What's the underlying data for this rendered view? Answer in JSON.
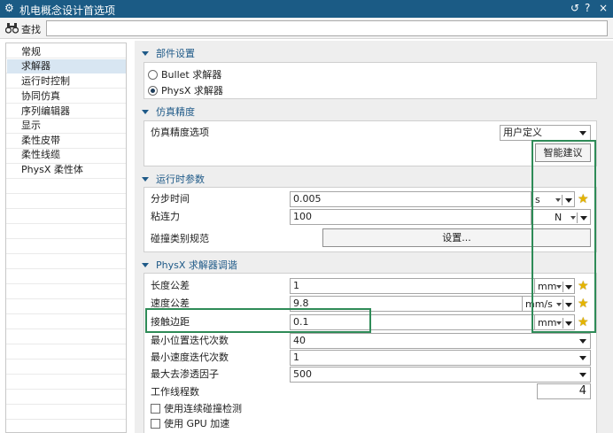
{
  "window": {
    "title": "机电概念设计首选项",
    "app_icon": "gear-icon",
    "controls": [
      "↺",
      "?",
      "×"
    ]
  },
  "search": {
    "label": "查找",
    "value": "",
    "icon": "binoculars-icon"
  },
  "sidebar": {
    "items": [
      {
        "label": "常规",
        "selected": false
      },
      {
        "label": "求解器",
        "selected": true
      },
      {
        "label": "运行时控制",
        "selected": false
      },
      {
        "label": "协同仿真",
        "selected": false
      },
      {
        "label": "序列编辑器",
        "selected": false
      },
      {
        "label": "显示",
        "selected": false
      },
      {
        "label": "柔性皮带",
        "selected": false
      },
      {
        "label": "柔性线缆",
        "selected": false
      },
      {
        "label": "PhysX 柔性体",
        "selected": false
      }
    ]
  },
  "sections": {
    "component": {
      "title": "部件设置",
      "options": [
        {
          "label": "Bullet 求解器",
          "checked": false
        },
        {
          "label": "PhysX 求解器",
          "checked": true
        }
      ]
    },
    "precision": {
      "title": "仿真精度",
      "option_label": "仿真精度选项",
      "option_value": "用户定义",
      "suggest_button": "智能建议"
    },
    "runtime": {
      "title": "运行时参数",
      "step_time": {
        "label": "分步时间",
        "value": "0.005",
        "unit": "s"
      },
      "adhesion": {
        "label": "粘连力",
        "value": "100",
        "unit": "N"
      },
      "collision": {
        "label": "碰撞类别规范",
        "button": "设置..."
      }
    },
    "physx": {
      "title": "PhysX 求解器调谐",
      "length_tol": {
        "label": "长度公差",
        "value": "1",
        "unit": "mm"
      },
      "speed_tol": {
        "label": "速度公差",
        "value": "9.8",
        "unit": "mm/s"
      },
      "contact_margin": {
        "label": "接触边距",
        "value": "0.1",
        "unit": "mm"
      },
      "min_pos_iter": {
        "label": "最小位置迭代次数",
        "value": "40"
      },
      "min_vel_iter": {
        "label": "最小速度迭代次数",
        "value": "1"
      },
      "max_penetration": {
        "label": "最大去渗透因子",
        "value": "500"
      },
      "worker_threads": {
        "label": "工作线程数",
        "value": "4"
      },
      "ccd": {
        "label": "使用连续碰撞检测",
        "checked": false
      },
      "gpu": {
        "label": "使用 GPU 加速",
        "checked": false
      }
    }
  },
  "colors": {
    "titlebar": "#1b5b85",
    "accent": "#1f5a88",
    "highlight": "#2e8b57",
    "star": "#e4b400",
    "selection": "#d8e6f2"
  }
}
